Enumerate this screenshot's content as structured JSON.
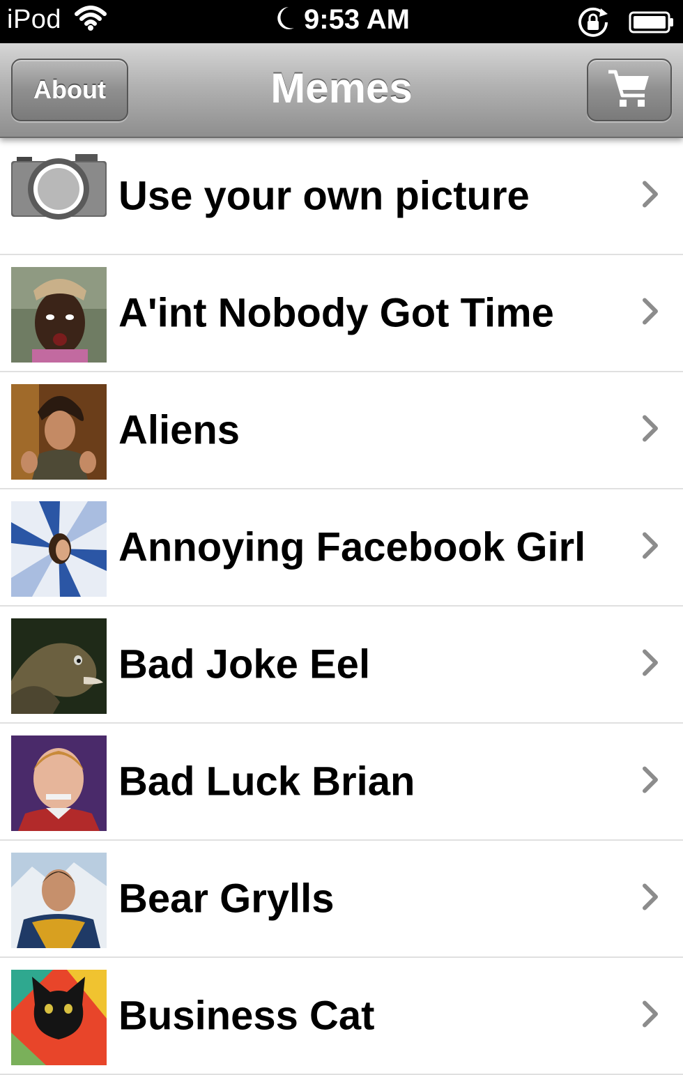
{
  "status_bar": {
    "carrier": "iPod",
    "time": "9:53 AM"
  },
  "nav": {
    "title": "Memes",
    "about_label": "About",
    "cart_icon": "cart-icon"
  },
  "rows": [
    {
      "label": "Use your own picture"
    },
    {
      "label": "A'int Nobody Got Time"
    },
    {
      "label": "Aliens"
    },
    {
      "label": "Annoying Facebook Girl"
    },
    {
      "label": "Bad Joke Eel"
    },
    {
      "label": "Bad Luck Brian"
    },
    {
      "label": "Bear Grylls"
    },
    {
      "label": "Business Cat"
    }
  ]
}
